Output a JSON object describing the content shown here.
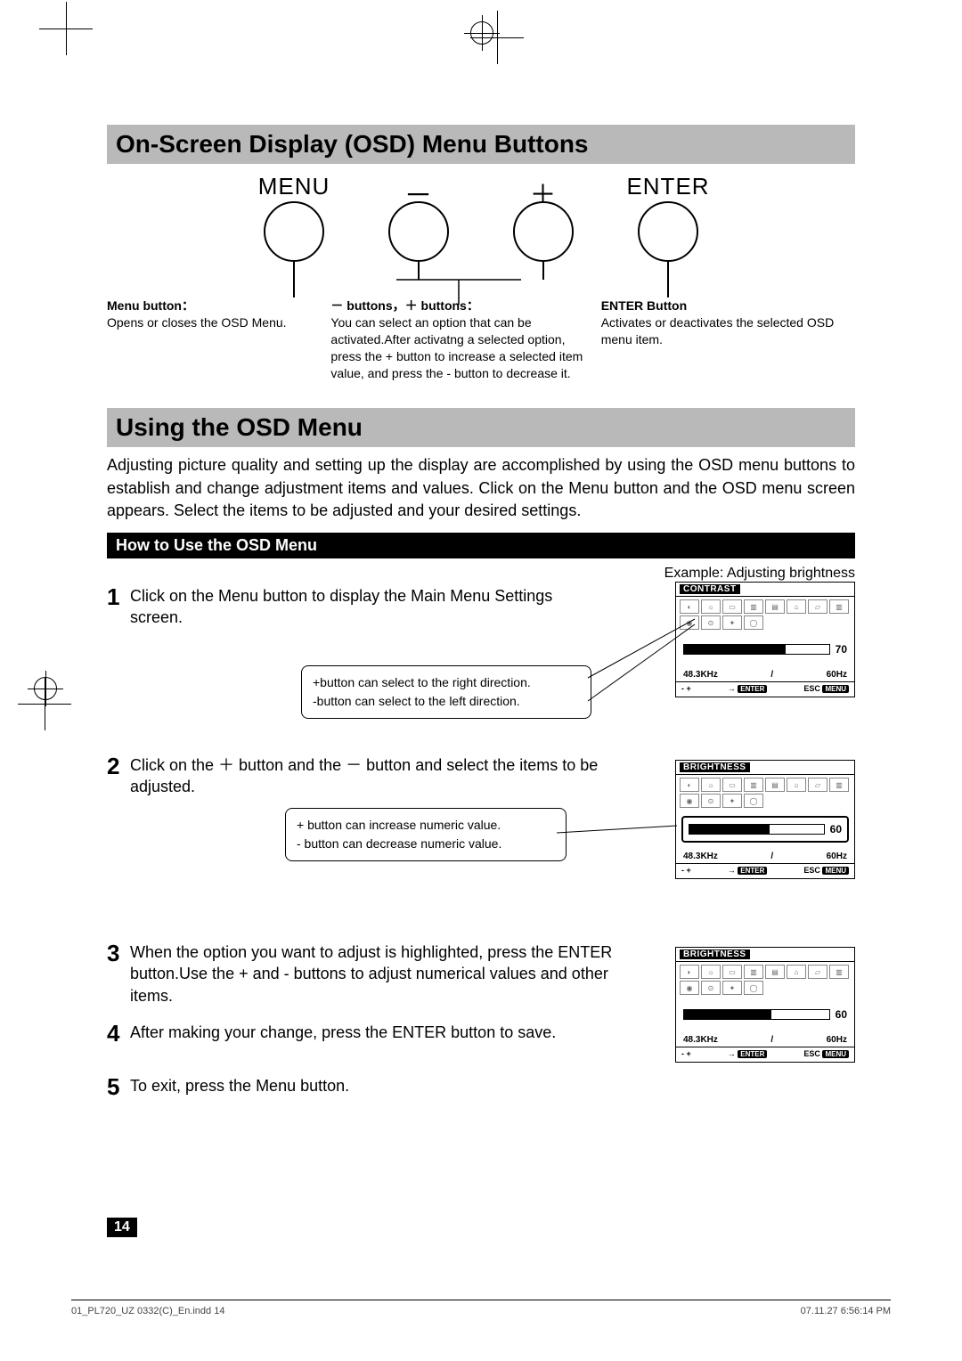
{
  "section1_title": "On-Screen Display (OSD) Menu Buttons",
  "buttons": {
    "menu_label": "MENU",
    "minus_label": "－",
    "plus_label": "＋",
    "enter_label": "ENTER"
  },
  "desc": {
    "menu_h": "Menu button：",
    "menu_t": "Opens or closes the OSD Menu.",
    "pm_h": "－ buttons，＋ buttons：",
    "pm_t": "You can select an option that can be activated.After activatng a selected option, press the + button to increase a selected item value, and press the - button to decrease it.",
    "enter_h": "ENTER Button",
    "enter_t": "Activates or deactivates the selected OSD menu item."
  },
  "section2_title": "Using the OSD Menu",
  "body": "Adjusting picture quality and setting up the display are accomplished by using the OSD menu buttons to establish and change adjustment items and values. Click on the Menu button and the OSD menu screen appears. Select the items to be adjusted and your desired settings.",
  "subhead": "How to Use the OSD Menu",
  "example_label": "Example: Adjusting brightness",
  "steps": {
    "s1_n": "1",
    "s1_t": "Click on the Menu button to display the Main Menu Settings screen.",
    "s2_n": "2",
    "s2_t": "Click on the ＋ button and the － button and select the items to be adjusted.",
    "s3_n": "3",
    "s3_t": "When the option you want to adjust is highlighted, press the ENTER button.Use the + and - buttons to adjust numerical values and other items.",
    "s4_n": "4",
    "s4_t": "After making your change, press the ENTER button to save.",
    "s5_n": "5",
    "s5_t": "To exit, press the Menu button."
  },
  "callout1_l1": "+button can select to the right direction.",
  "callout1_l2": "-button can select to the left direction.",
  "callout2_l1": "+ button can increase numeric value.",
  "callout2_l2": "- button can decrease numeric value.",
  "osd": {
    "contrast_title": "CONTRAST",
    "brightness_title": "BRIGHTNESS",
    "val70": "70",
    "val60": "60",
    "freq": "48.3KHz",
    "slash": "/",
    "hz": "60Hz",
    "mp": "- +",
    "arrow": "→",
    "enter_tag": "ENTER",
    "esc": "ESC",
    "menu_tag": "MENU"
  },
  "page_number": "14",
  "footer_left": "01_PL720_UZ 0332(C)_En.indd   14",
  "footer_right": "07.11.27   6:56:14 PM"
}
